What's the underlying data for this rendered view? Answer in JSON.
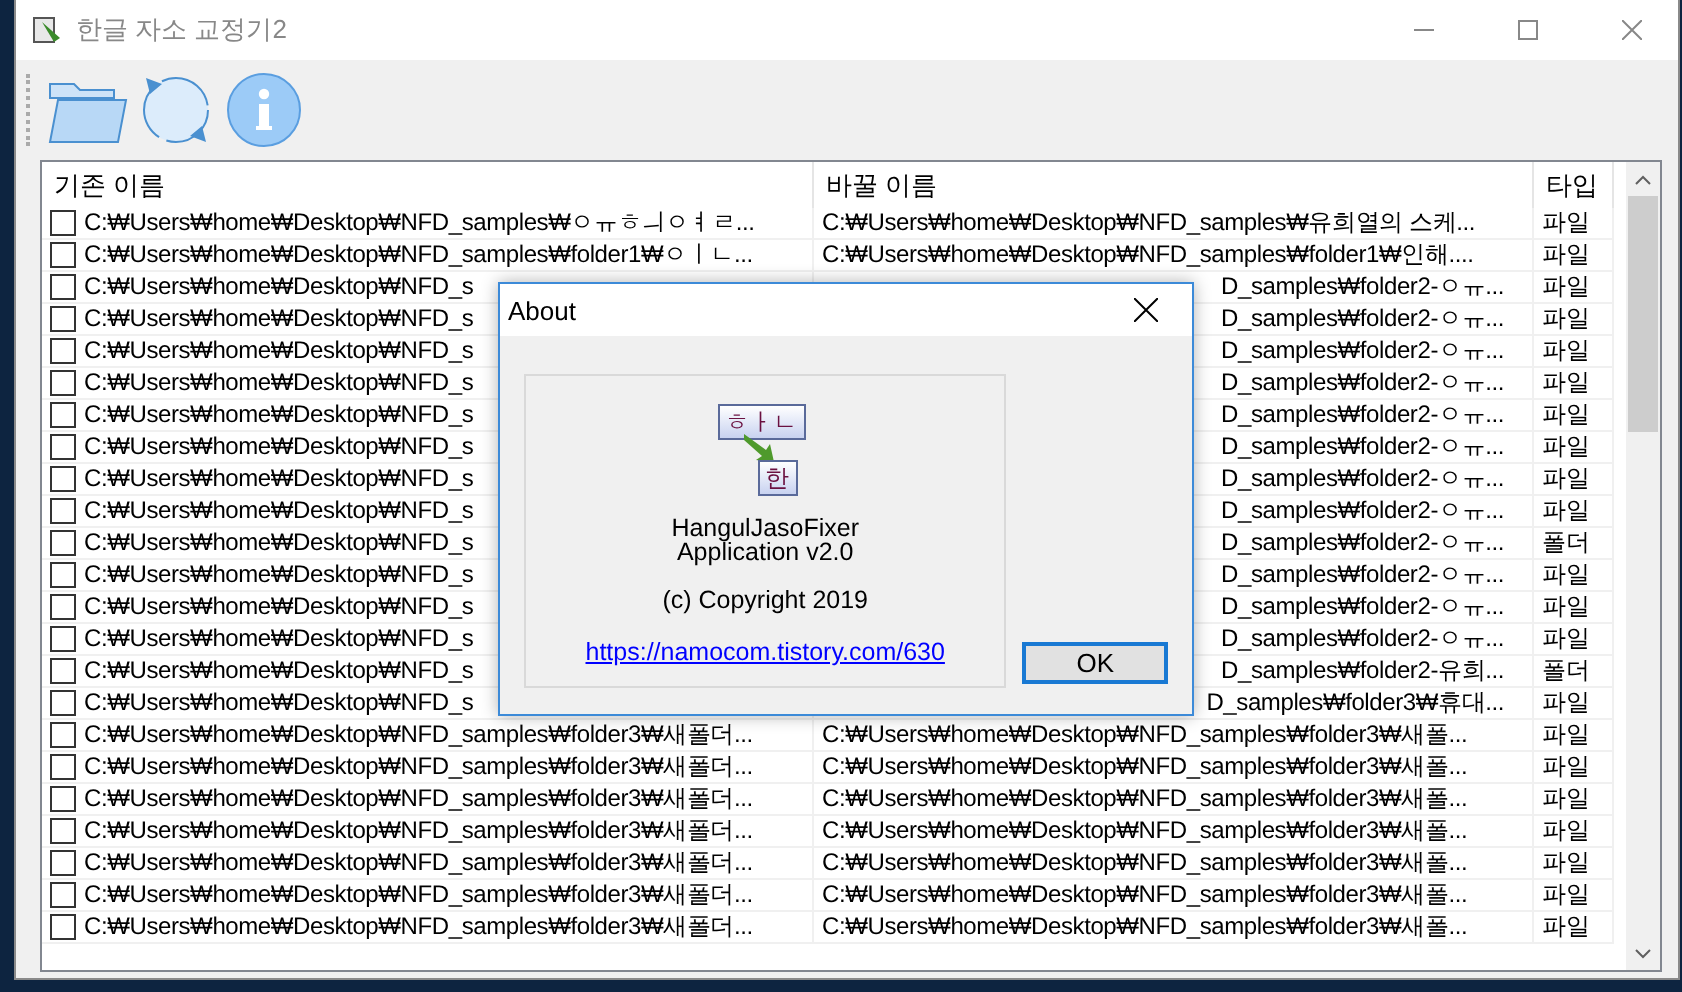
{
  "window": {
    "title": "한글 자소 교정기2"
  },
  "table": {
    "columns": [
      "기존 이름",
      "바꿀 이름",
      "타입"
    ],
    "rows": [
      {
        "checked": false,
        "original": "C:₩Users₩home₩Desktop₩NFD_samples₩ㅇㅠㅎㅢㅇㅕㄹ...",
        "renamed": "C:₩Users₩home₩Desktop₩NFD_samples₩유희열의 스케...",
        "type": "파일"
      },
      {
        "checked": false,
        "original": "C:₩Users₩home₩Desktop₩NFD_samples₩folder1₩ㅇㅣㄴ...",
        "renamed": "C:₩Users₩home₩Desktop₩NFD_samples₩folder1₩인해....",
        "type": "파일"
      },
      {
        "checked": false,
        "original": "C:₩Users₩home₩Desktop₩NFD_s",
        "renamed": "D_samples₩folder2-ㅇㅠ...",
        "type": "파일"
      },
      {
        "checked": false,
        "original": "C:₩Users₩home₩Desktop₩NFD_s",
        "renamed": "D_samples₩folder2-ㅇㅠ...",
        "type": "파일"
      },
      {
        "checked": false,
        "original": "C:₩Users₩home₩Desktop₩NFD_s",
        "renamed": "D_samples₩folder2-ㅇㅠ...",
        "type": "파일"
      },
      {
        "checked": false,
        "original": "C:₩Users₩home₩Desktop₩NFD_s",
        "renamed": "D_samples₩folder2-ㅇㅠ...",
        "type": "파일"
      },
      {
        "checked": false,
        "original": "C:₩Users₩home₩Desktop₩NFD_s",
        "renamed": "D_samples₩folder2-ㅇㅠ...",
        "type": "파일"
      },
      {
        "checked": false,
        "original": "C:₩Users₩home₩Desktop₩NFD_s",
        "renamed": "D_samples₩folder2-ㅇㅠ...",
        "type": "파일"
      },
      {
        "checked": false,
        "original": "C:₩Users₩home₩Desktop₩NFD_s",
        "renamed": "D_samples₩folder2-ㅇㅠ...",
        "type": "파일"
      },
      {
        "checked": false,
        "original": "C:₩Users₩home₩Desktop₩NFD_s",
        "renamed": "D_samples₩folder2-ㅇㅠ...",
        "type": "파일"
      },
      {
        "checked": false,
        "original": "C:₩Users₩home₩Desktop₩NFD_s",
        "renamed": "D_samples₩folder2-ㅇㅠ...",
        "type": "폴더"
      },
      {
        "checked": false,
        "original": "C:₩Users₩home₩Desktop₩NFD_s",
        "renamed": "D_samples₩folder2-ㅇㅠ...",
        "type": "파일"
      },
      {
        "checked": false,
        "original": "C:₩Users₩home₩Desktop₩NFD_s",
        "renamed": "D_samples₩folder2-ㅇㅠ...",
        "type": "파일"
      },
      {
        "checked": false,
        "original": "C:₩Users₩home₩Desktop₩NFD_s",
        "renamed": "D_samples₩folder2-ㅇㅠ...",
        "type": "파일"
      },
      {
        "checked": false,
        "original": "C:₩Users₩home₩Desktop₩NFD_s",
        "renamed": "D_samples₩folder2-유희...",
        "type": "폴더"
      },
      {
        "checked": false,
        "original": "C:₩Users₩home₩Desktop₩NFD_s",
        "renamed": "D_samples₩folder3₩휴대...",
        "type": "파일"
      },
      {
        "checked": false,
        "original": "C:₩Users₩home₩Desktop₩NFD_samples₩folder3₩새폴더...",
        "renamed": "C:₩Users₩home₩Desktop₩NFD_samples₩folder3₩새폴...",
        "type": "파일"
      },
      {
        "checked": false,
        "original": "C:₩Users₩home₩Desktop₩NFD_samples₩folder3₩새폴더...",
        "renamed": "C:₩Users₩home₩Desktop₩NFD_samples₩folder3₩새폴...",
        "type": "파일"
      },
      {
        "checked": false,
        "original": "C:₩Users₩home₩Desktop₩NFD_samples₩folder3₩새폴더...",
        "renamed": "C:₩Users₩home₩Desktop₩NFD_samples₩folder3₩새폴...",
        "type": "파일"
      },
      {
        "checked": false,
        "original": "C:₩Users₩home₩Desktop₩NFD_samples₩folder3₩새폴더...",
        "renamed": "C:₩Users₩home₩Desktop₩NFD_samples₩folder3₩새폴...",
        "type": "파일"
      },
      {
        "checked": false,
        "original": "C:₩Users₩home₩Desktop₩NFD_samples₩folder3₩새폴더...",
        "renamed": "C:₩Users₩home₩Desktop₩NFD_samples₩folder3₩새폴...",
        "type": "파일"
      },
      {
        "checked": false,
        "original": "C:₩Users₩home₩Desktop₩NFD_samples₩folder3₩새폴더...",
        "renamed": "C:₩Users₩home₩Desktop₩NFD_samples₩folder3₩새폴...",
        "type": "파일"
      },
      {
        "checked": false,
        "original": "C:₩Users₩home₩Desktop₩NFD_samples₩folder3₩새폴더...",
        "renamed": "C:₩Users₩home₩Desktop₩NFD_samples₩folder3₩새폴...",
        "type": "파일"
      }
    ]
  },
  "dialog": {
    "title": "About",
    "logo": {
      "top": "ㅎㅏㄴ",
      "bottom": "한"
    },
    "product": "HangulJasoFixer",
    "version": "Application v2.0",
    "copyright": "(c) Copyright 2019",
    "link": "https://namocom.tistory.com/630",
    "button": "OK"
  }
}
